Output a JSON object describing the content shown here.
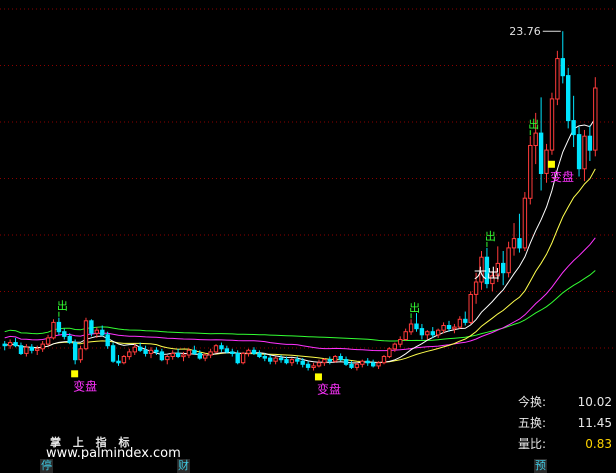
{
  "colors": {
    "background": "#000000",
    "grid": "#8b0000",
    "up_candle": "#ff3b3b",
    "down_candle": "#00e5ff",
    "ma_white": "#ffffff",
    "ma_yellow": "#ffff4d",
    "ma_magenta": "#ff33ff",
    "ma_green": "#33ff33",
    "signal_green": "#33ff33",
    "label_magenta": "#ff33ff",
    "marker_yellow": "#ffff00"
  },
  "chart_data": {
    "type": "candlestick",
    "x": [
      1,
      2,
      3,
      4,
      5,
      6,
      7,
      8,
      9,
      10,
      11,
      12,
      13,
      14,
      15,
      16,
      17,
      18,
      19,
      20,
      21,
      22,
      23,
      24,
      25,
      26,
      27,
      28,
      29,
      30,
      31,
      32,
      33,
      34,
      35,
      36,
      37,
      38,
      39,
      40,
      41,
      42,
      43,
      44,
      45,
      46,
      47,
      48,
      49,
      50,
      51,
      52,
      53,
      54,
      55,
      56,
      57,
      58,
      59,
      60,
      61,
      62,
      63,
      64,
      65,
      66,
      67,
      68,
      69,
      70,
      71,
      72,
      73,
      74,
      75,
      76,
      77,
      78,
      79,
      80,
      81,
      82,
      83,
      84,
      85,
      86,
      87,
      88,
      89,
      90,
      91,
      92,
      93,
      94,
      95,
      96,
      97,
      98,
      99,
      100
    ],
    "ylim": [
      0,
      25
    ],
    "max_label": "23.76",
    "signals": [
      {
        "index": 10,
        "text": "出",
        "kind": "sell"
      },
      {
        "index": 75,
        "text": "出",
        "kind": "sell"
      },
      {
        "index": 89,
        "text": "出",
        "kind": "sell"
      },
      {
        "index": 97,
        "text": "出",
        "kind": "sell"
      },
      {
        "index": 89,
        "text": "大出",
        "kind": "big-sell"
      }
    ],
    "change_labels": [
      {
        "index": 13,
        "text": "变盘"
      },
      {
        "index": 58,
        "text": "变盘"
      },
      {
        "index": 101,
        "text": "变盘"
      }
    ],
    "candles": [
      [
        3.6,
        3.8,
        3.2,
        3.5
      ],
      [
        3.5,
        3.9,
        3.3,
        3.7
      ],
      [
        3.7,
        4.0,
        3.4,
        3.5
      ],
      [
        3.5,
        3.7,
        2.9,
        3.0
      ],
      [
        3.0,
        3.6,
        2.8,
        3.4
      ],
      [
        3.4,
        3.6,
        3.0,
        3.2
      ],
      [
        3.2,
        3.5,
        2.9,
        3.3
      ],
      [
        3.3,
        3.8,
        3.1,
        3.6
      ],
      [
        3.6,
        4.2,
        3.5,
        4.0
      ],
      [
        4.0,
        5.2,
        3.9,
        5.0
      ],
      [
        5.0,
        5.3,
        4.2,
        4.4
      ],
      [
        4.4,
        4.6,
        3.9,
        4.1
      ],
      [
        4.1,
        4.3,
        3.6,
        3.7
      ],
      [
        3.7,
        3.9,
        2.3,
        2.6
      ],
      [
        2.6,
        3.5,
        2.4,
        3.3
      ],
      [
        3.3,
        5.3,
        3.2,
        5.1
      ],
      [
        5.1,
        5.2,
        4.1,
        4.3
      ],
      [
        4.3,
        4.7,
        4.0,
        4.5
      ],
      [
        4.5,
        4.8,
        4.1,
        4.2
      ],
      [
        4.2,
        4.4,
        3.3,
        3.5
      ],
      [
        3.5,
        3.7,
        2.4,
        2.5
      ],
      [
        2.5,
        2.9,
        2.2,
        2.4
      ],
      [
        2.4,
        2.9,
        2.3,
        2.8
      ],
      [
        2.8,
        3.3,
        2.6,
        3.1
      ],
      [
        3.1,
        3.6,
        2.9,
        3.4
      ],
      [
        3.4,
        3.7,
        3.1,
        3.2
      ],
      [
        3.2,
        3.5,
        2.8,
        3.0
      ],
      [
        3.0,
        3.4,
        2.7,
        3.2
      ],
      [
        3.2,
        3.4,
        2.9,
        3.1
      ],
      [
        3.1,
        3.3,
        2.5,
        2.6
      ],
      [
        2.6,
        2.9,
        2.3,
        2.8
      ],
      [
        2.8,
        3.2,
        2.6,
        3.0
      ],
      [
        3.0,
        3.3,
        2.7,
        2.8
      ],
      [
        2.8,
        3.1,
        2.5,
        2.9
      ],
      [
        2.9,
        3.3,
        2.7,
        3.2
      ],
      [
        3.2,
        3.5,
        2.9,
        3.0
      ],
      [
        3.0,
        3.2,
        2.6,
        2.7
      ],
      [
        2.7,
        3.0,
        2.5,
        2.9
      ],
      [
        2.9,
        3.3,
        2.7,
        3.1
      ],
      [
        3.1,
        3.6,
        3.0,
        3.5
      ],
      [
        3.5,
        3.7,
        3.1,
        3.3
      ],
      [
        3.3,
        3.5,
        3.0,
        3.1
      ],
      [
        3.1,
        3.3,
        2.8,
        3.0
      ],
      [
        3.0,
        3.2,
        2.3,
        2.4
      ],
      [
        2.4,
        3.1,
        2.3,
        3.0
      ],
      [
        3.0,
        3.3,
        2.8,
        3.2
      ],
      [
        3.2,
        3.4,
        2.9,
        3.0
      ],
      [
        3.0,
        3.2,
        2.7,
        2.8
      ],
      [
        2.8,
        3.0,
        2.5,
        2.7
      ],
      [
        2.7,
        2.9,
        2.3,
        2.5
      ],
      [
        2.5,
        2.8,
        2.3,
        2.7
      ],
      [
        2.7,
        2.9,
        2.4,
        2.6
      ],
      [
        2.6,
        2.8,
        2.3,
        2.4
      ],
      [
        2.4,
        2.7,
        2.2,
        2.6
      ],
      [
        2.6,
        2.8,
        2.3,
        2.5
      ],
      [
        2.5,
        2.7,
        2.1,
        2.3
      ],
      [
        2.3,
        2.5,
        1.9,
        2.1
      ],
      [
        2.1,
        2.4,
        1.9,
        2.2
      ],
      [
        2.2,
        2.6,
        2.1,
        2.4
      ],
      [
        2.4,
        2.7,
        2.2,
        2.6
      ],
      [
        2.6,
        2.8,
        2.3,
        2.5
      ],
      [
        2.5,
        2.9,
        2.4,
        2.8
      ],
      [
        2.8,
        3.0,
        2.5,
        2.6
      ],
      [
        2.6,
        2.8,
        2.2,
        2.3
      ],
      [
        2.3,
        2.5,
        2.0,
        2.1
      ],
      [
        2.1,
        2.4,
        1.9,
        2.3
      ],
      [
        2.3,
        2.6,
        2.1,
        2.5
      ],
      [
        2.5,
        2.7,
        2.2,
        2.4
      ],
      [
        2.4,
        2.6,
        2.1,
        2.2
      ],
      [
        2.2,
        2.5,
        2.0,
        2.4
      ],
      [
        2.4,
        2.9,
        2.3,
        2.8
      ],
      [
        2.8,
        3.4,
        2.7,
        3.3
      ],
      [
        3.3,
        3.7,
        3.1,
        3.6
      ],
      [
        3.6,
        4.1,
        3.4,
        3.9
      ],
      [
        3.9,
        4.6,
        3.8,
        4.4
      ],
      [
        4.4,
        5.2,
        4.2,
        4.9
      ],
      [
        4.9,
        5.6,
        4.4,
        4.6
      ],
      [
        4.6,
        4.9,
        3.9,
        4.2
      ],
      [
        4.2,
        4.5,
        3.9,
        4.4
      ],
      [
        4.4,
        4.7,
        4.0,
        4.2
      ],
      [
        4.2,
        4.6,
        4.0,
        4.5
      ],
      [
        4.5,
        5.0,
        4.3,
        4.8
      ],
      [
        4.8,
        5.1,
        4.4,
        4.6
      ],
      [
        4.6,
        4.9,
        4.3,
        4.7
      ],
      [
        4.7,
        5.4,
        4.6,
        5.2
      ],
      [
        5.2,
        5.7,
        4.8,
        5.0
      ],
      [
        5.0,
        7.0,
        4.9,
        6.8
      ],
      [
        6.8,
        8.2,
        6.2,
        7.6
      ],
      [
        7.6,
        9.6,
        7.1,
        9.2
      ],
      [
        9.2,
        9.8,
        7.2,
        7.5
      ],
      [
        7.5,
        8.3,
        7.0,
        8.0
      ],
      [
        8.0,
        9.9,
        7.6,
        8.8
      ],
      [
        8.8,
        9.6,
        7.4,
        8.2
      ],
      [
        8.2,
        10.2,
        7.9,
        9.8
      ],
      [
        9.8,
        11.4,
        9.3,
        10.4
      ],
      [
        10.4,
        12.0,
        9.5,
        9.8
      ],
      [
        9.8,
        13.4,
        9.6,
        13.0
      ],
      [
        13.0,
        17.0,
        12.6,
        16.4
      ],
      [
        16.4,
        18.5,
        15.2,
        17.2
      ],
      [
        17.2,
        19.5,
        13.5,
        14.6
      ],
      [
        14.6,
        16.5,
        14.0,
        16.1
      ],
      [
        16.1,
        19.8,
        15.8,
        19.4
      ],
      [
        19.4,
        22.5,
        19.0,
        22.0
      ],
      [
        22.0,
        23.76,
        20.4,
        20.9
      ],
      [
        20.9,
        21.4,
        17.5,
        18.0
      ],
      [
        18.0,
        19.6,
        16.3,
        17.1
      ],
      [
        17.1,
        17.6,
        14.4,
        14.9
      ],
      [
        14.9,
        17.4,
        14.1,
        17.0
      ],
      [
        17.0,
        17.7,
        15.4,
        16.1
      ],
      [
        16.1,
        20.8,
        15.7,
        20.1
      ]
    ]
  },
  "stats": {
    "today_turnover_label": "今换:",
    "today_turnover_value": "10.02",
    "five_turnover_label": "五换:",
    "five_turnover_value": "11.45",
    "volume_ratio_label": "量比:",
    "volume_ratio_value": "0.83"
  },
  "brand": {
    "name": "掌 上 指 标",
    "watermark": "www.palmindex.com"
  },
  "bottom_bar": {
    "tag_stop": "停",
    "tag_finance": "财",
    "tag_forecast": "预"
  }
}
